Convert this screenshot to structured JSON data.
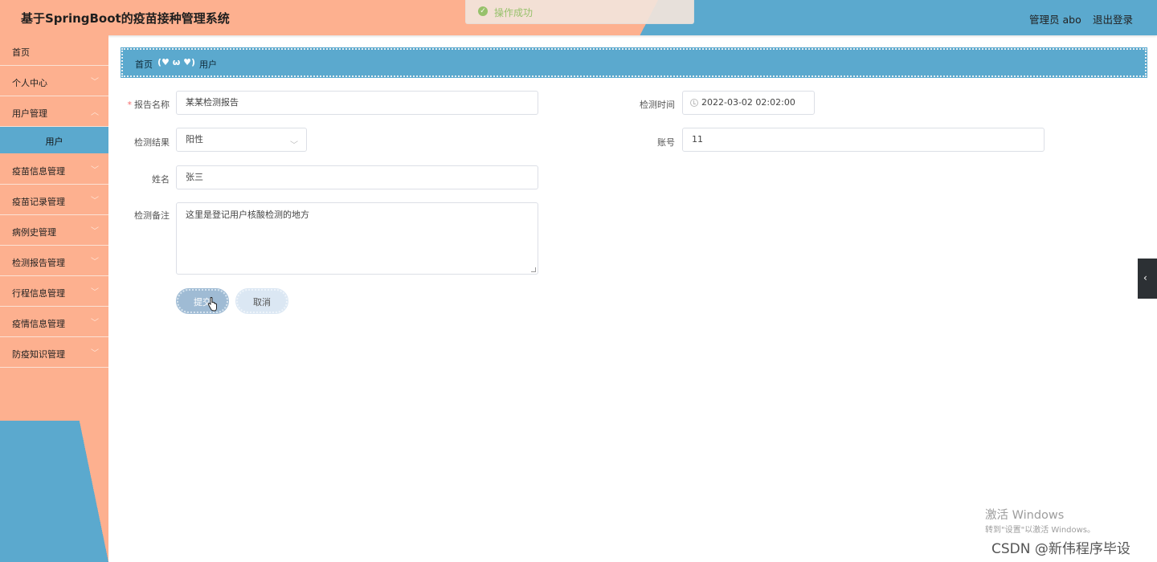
{
  "header": {
    "title": "基于SpringBoot的疫苗接种管理系统",
    "user": "管理员 abo",
    "logout": "退出登录"
  },
  "toast": {
    "message": "操作成功"
  },
  "sidebar": {
    "items": [
      {
        "label": "首页"
      },
      {
        "label": "个人中心"
      },
      {
        "label": "用户管理"
      },
      {
        "label": "疫苗信息管理"
      },
      {
        "label": "疫苗记录管理"
      },
      {
        "label": "病例史管理"
      },
      {
        "label": "检测报告管理"
      },
      {
        "label": "行程信息管理"
      },
      {
        "label": "疫情信息管理"
      },
      {
        "label": "防疫知识管理"
      }
    ],
    "active_sub": "用户"
  },
  "breadcrumb": {
    "home": "首页",
    "separator": "(♥ ω ♥)",
    "current": "用户"
  },
  "form": {
    "report_name_label": "报告名称",
    "report_name_value": "某某检测报告",
    "check_time_label": "检测时间",
    "check_time_value": "2022-03-02 02:02:00",
    "result_label": "检测结果",
    "result_value": "阳性",
    "account_label": "账号",
    "account_value": "11",
    "name_label": "姓名",
    "name_value": "张三",
    "remark_label": "检测备注",
    "remark_value": "这里是登记用户核酸检测的地方",
    "submit": "提交",
    "cancel": "取消"
  },
  "watermark": {
    "activate_title": "激活 Windows",
    "activate_hint": "转到\"设置\"以激活 Windows。",
    "csdn": "CSDN @新伟程序毕设"
  }
}
